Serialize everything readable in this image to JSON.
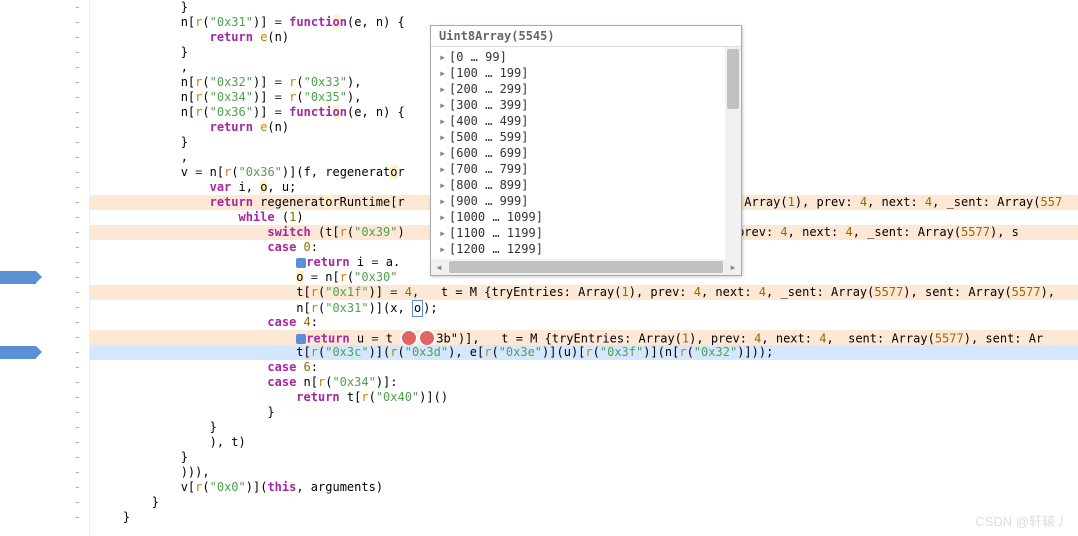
{
  "popup": {
    "header": "Uint8Array(5545)",
    "items": [
      "[0 … 99]",
      "[100 … 199]",
      "[200 … 299]",
      "[300 … 399]",
      "[400 … 499]",
      "[500 … 599]",
      "[600 … 699]",
      "[700 … 799]",
      "[800 … 899]",
      "[900 … 999]",
      "[1000 … 1099]",
      "[1100 … 1199]",
      "[1200 … 1299]"
    ]
  },
  "code": {
    "l1": "            }",
    "l2": "            n[r(\"0x31\")] = function(e, n) {",
    "l2b": "                return e(n)",
    "l2c": "            }",
    "l2d": "            ,",
    "l3": "            n[r(\"0x32\")] = r(\"0x33\"),",
    "l4": "            n[r(\"0x34\")] = r(\"0x35\"),",
    "l5": "            n[r(\"0x36\")] = function(e, n) {",
    "l5b": "                return e(n)",
    "l5c": "            }",
    "l5d": "            ,",
    "l6": "            v = n[r(\"0x36\")](f, regenerator",
    "l7": "                var i, o, u;",
    "l8": "                return regeneratorRuntime[",
    "l8eval": "Array(1), prev: 4, next: 4, _sent: Array(557",
    "l9": "                    while (1)",
    "l10": "                        switch (t[r(\"0x39\")",
    "l10eval": "(1), prev: 4, next: 4, _sent: Array(5577), s",
    "l11": "                        case 0:",
    "l12a": "                            ",
    "l12b": "return i = a.",
    "l13a": "                            o = n[r(\"0x30\"",
    "l14a": "                            t[r(\"0x1f\")] = 4",
    "l14eval": "  t = M {tryEntries: Array(1), prev: 4, next: 4, _sent: Array(5577), sent: Array(5577),",
    "l15": "                            n[r(\"0x31\")](x, ",
    "l15o": "o",
    "l15end": ");",
    "l16": "                        case 4:",
    "l17a": "                            ",
    "l17b": "return u = t",
    "l17c": "3b\")],",
    "l17eval": "  t = M {tryEntries: Array(1), prev: 4, next: 4, _sent: Array(5577), sent: Ar",
    "l18": "                            t[r(\"0x3c\")](r(\"0x3d\"), e[r(\"0x3e\")](u)[r(\"0x3f\")](n[r(\"0x32\")]));",
    "l19": "                        case 6:",
    "l20": "                        case n[r(\"0x34\")]:",
    "l21": "                            return t[r(\"0x40\")]()",
    "l22": "                        }",
    "l23": "                }",
    "l24": "                ), t)",
    "l25": "            }",
    "l26": "            ))),",
    "l27": "            v[r(\"0x0\")](this, arguments)",
    "l28": "        }",
    "l29": "    }"
  },
  "watermark": "CSDN @轩辕丿"
}
